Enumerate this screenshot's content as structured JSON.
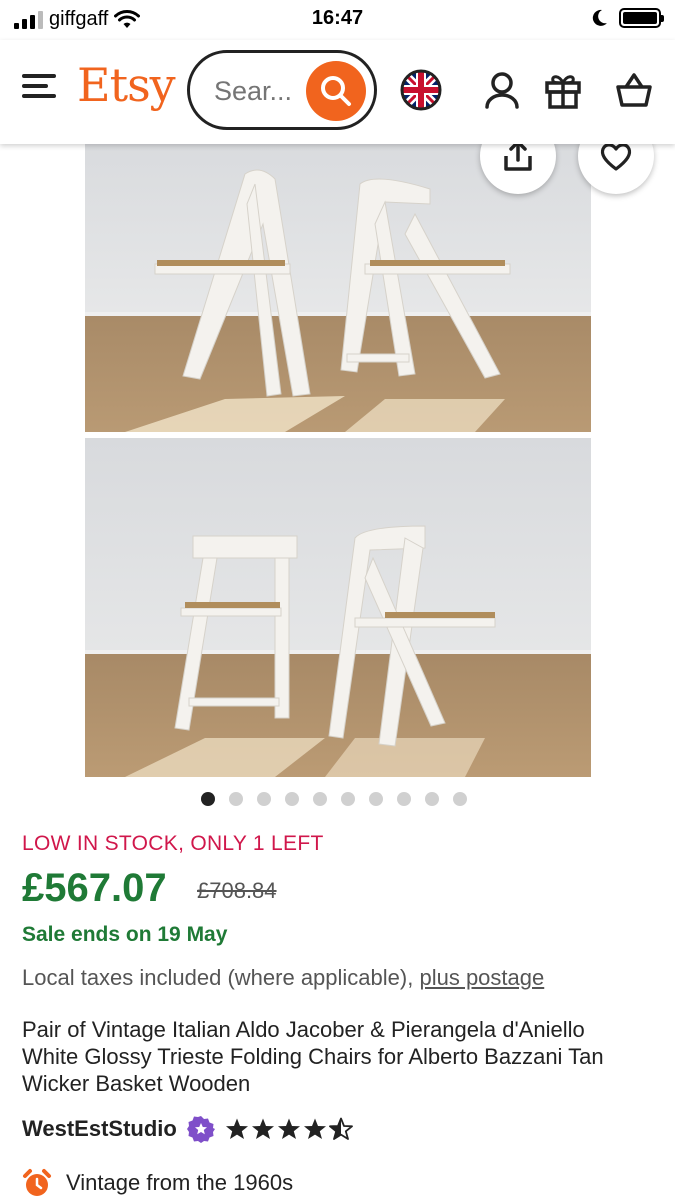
{
  "status_bar": {
    "carrier": "giffgaff",
    "time": "16:47"
  },
  "header": {
    "logo": "Etsy",
    "search_placeholder": "Sear...",
    "icons": [
      "menu-icon",
      "search-icon",
      "uk-flag-icon",
      "user-icon",
      "gift-icon",
      "basket-icon"
    ]
  },
  "gallery": {
    "image_count": 10,
    "active_index": 0,
    "actions": [
      "share-icon",
      "heart-icon"
    ]
  },
  "product": {
    "stock_message": "LOW IN STOCK, ONLY 1 LEFT",
    "price": "£567.07",
    "original_price": "£708.84",
    "sale_message": "Sale ends on 19 May",
    "taxes_text": "Local taxes included (where applicable),",
    "postage_link": "plus postage",
    "title": "Pair of Vintage Italian Aldo Jacober & Pierangela d'Aniello White Glossy Trieste Folding Chairs for Alberto Bazzani Tan Wicker Basket Wooden",
    "shop_name": "WestEstStudio",
    "rating": 4.5,
    "vintage_label": "Vintage from the 1960s"
  },
  "colors": {
    "brand": "#F1641E",
    "price_green": "#1F7A36",
    "stock_red": "#D0174B",
    "badge_purple": "#7F4FC9"
  }
}
